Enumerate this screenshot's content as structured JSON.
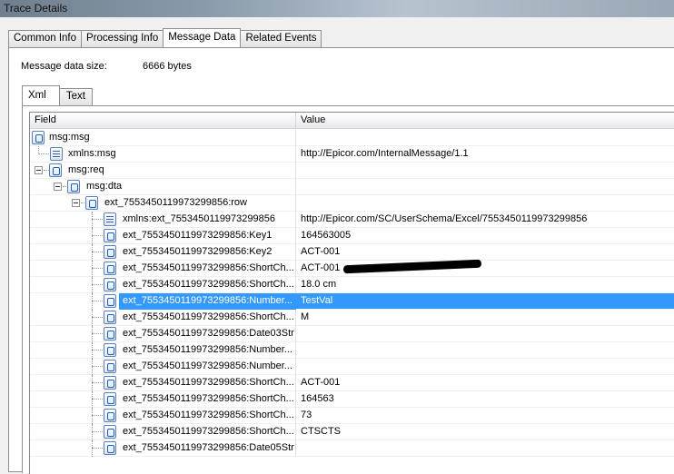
{
  "window": {
    "title": "Trace Details"
  },
  "tabs": [
    {
      "label": "Common Info"
    },
    {
      "label": "Processing Info"
    },
    {
      "label": "Message Data"
    },
    {
      "label": "Related Events"
    }
  ],
  "message_size": {
    "label": "Message data size:",
    "value": "6666 bytes"
  },
  "subtabs": [
    {
      "label": "Xml"
    },
    {
      "label": "Text"
    }
  ],
  "grid": {
    "columns": {
      "field": "Field",
      "value": "Value"
    },
    "rows": [
      {
        "field": "msg:msg",
        "value": ""
      },
      {
        "field": "xmlns:msg",
        "value": "http://Epicor.com/InternalMessage/1.1"
      },
      {
        "field": "msg:req",
        "value": ""
      },
      {
        "field": "msg:dta",
        "value": ""
      },
      {
        "field": "ext_7553450119973299856:row",
        "value": ""
      },
      {
        "field": "xmlns:ext_7553450119973299856",
        "value": "http://Epicor.com/SC/UserSchema/Excel/7553450119973299856"
      },
      {
        "field": "ext_7553450119973299856:Key1",
        "value": "164563005"
      },
      {
        "field": "ext_7553450119973299856:Key2",
        "value": "ACT-001"
      },
      {
        "field": "ext_7553450119973299856:ShortCh...",
        "value": "ACT-001"
      },
      {
        "field": "ext_7553450119973299856:ShortCh...",
        "value": "18.0 cm"
      },
      {
        "field": "ext_7553450119973299856:Number...",
        "value": "TestVal"
      },
      {
        "field": "ext_7553450119973299856:ShortCh...",
        "value": "M"
      },
      {
        "field": "ext_7553450119973299856:Date03Str",
        "value": ""
      },
      {
        "field": "ext_7553450119973299856:Number...",
        "value": ""
      },
      {
        "field": "ext_7553450119973299856:Number...",
        "value": ""
      },
      {
        "field": "ext_7553450119973299856:ShortCh...",
        "value": "ACT-001"
      },
      {
        "field": "ext_7553450119973299856:ShortCh...",
        "value": "164563"
      },
      {
        "field": "ext_7553450119973299856:ShortCh...",
        "value": "73"
      },
      {
        "field": "ext_7553450119973299856:ShortCh...",
        "value": "CTSCTS"
      },
      {
        "field": "ext_7553450119973299856:Date05Str",
        "value": ""
      }
    ]
  },
  "icons": {
    "element": "xml-element-icon",
    "attribute": "xml-attribute-icon",
    "toggle": "collapse-toggle-icon"
  }
}
